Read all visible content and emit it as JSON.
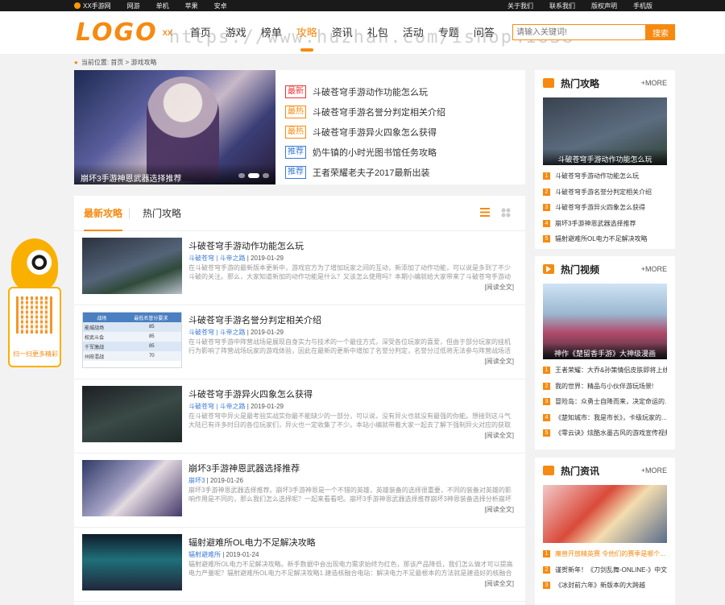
{
  "topbar": {
    "left": [
      "XX手游网",
      "网游",
      "单机",
      "苹果",
      "安卓"
    ],
    "right": [
      "关于我们",
      "联系我们",
      "版权声明",
      "手机版"
    ]
  },
  "header": {
    "logo": "LOGO",
    "logo_tag": "XX",
    "watermark": "https://www.huzhan.com/ishop41638",
    "nav": [
      "首页",
      "游戏",
      "榜单",
      "攻略",
      "资讯",
      "礼包",
      "活动",
      "专题",
      "问答"
    ],
    "search_placeholder": "请输入关键词!",
    "search_button": "搜索"
  },
  "breadcrumb": {
    "label": "当前位置:",
    "home": "首页",
    "sep": ">",
    "current": "游戏攻略"
  },
  "feature": {
    "slide_caption": "崩坏3手游神恩武器选择推荐",
    "items": [
      {
        "tag": "最新",
        "title": "斗破苍穹手游动作功能怎么玩"
      },
      {
        "tag": "最热",
        "title": "斗破苍穹手游名誉分判定相关介绍"
      },
      {
        "tag": "最热",
        "title": "斗破苍穹手游异火四象怎么获得"
      },
      {
        "tag": "推荐",
        "title": "奶牛镇的小时光图书馆任务攻略"
      },
      {
        "tag": "推荐",
        "title": "王者荣耀老夫子2017最新出装"
      }
    ]
  },
  "main": {
    "tabs": [
      "最新攻略",
      "热门攻略"
    ],
    "readmore": "[阅读全文]",
    "articles": [
      {
        "title": "斗破苍穹手游动作功能怎么玩",
        "author": "斗破苍穹 | 斗帝之路",
        "date": "2019-01-29",
        "desc": "在斗破苍穹手游的最新版本更新中，游戏官方为了增加玩家之间的互动，新添加了动作功能，可以说是多到了不少斗破的关注。那么，大家知道新加的动作功能是什么？又该怎么使用吗？本期小编就给大家带来了斗破苍穹手游动作功能怎么玩的"
      },
      {
        "title": "斗破苍穹手游名誉分判定相关介绍",
        "author": "斗破苍穹 | 斗帝之路",
        "date": "2019-01-29",
        "desc": "在斗破苍穹手游中阵营战场是展现自身实力与技术的一个最佳方式，深受各位玩家的喜爱，但由于部分玩家的挂机行为影响了阵营战场玩家的游戏体验，因此在最新的更新中增加了名誉分判定，名誉分过低将无法参与阵营战场活动。那么，斗破苍穹"
      },
      {
        "title": "斗破苍穹手游异火四象怎么获得",
        "author": "斗破苍穹 | 斗帝之路",
        "date": "2019-01-29",
        "desc": "在斗破苍穹中异火是最考验实战实你最不能缺少的一部分，可以说，没有异火也就没有最强的你能。想接到这斗气大陆已有许多时日的各位玩家们，异火也一定收集了不少。本站小编就带着大家一起去了解下强制异火对应的获取——异火四象，下面"
      },
      {
        "title": "崩坏3手游神恩武器选择推荐",
        "author": "崩坏3",
        "date": "2019-01-26",
        "desc": "崩坏3手游神恩武器选择推荐。崩坏3手游神恩是一个不错的英雄，英雄装备的选择很重要，不同的装备对英雄的影响作用是不同的，那么我们怎么选择呢？一起来看看吧。崩坏3手游神恩武器选择推荐崩坏3神恩装备选择分析崩坏3的我大-血之游戏"
      },
      {
        "title": "辐射避难所OL电力不足解决攻略",
        "author": "辐射避难所",
        "date": "2019-01-24",
        "desc": "辐射避难所OL电力不足解决攻略。新手数据中会出现电力需求始终为红色，那该产品降低，我们怎么做才可以提高电力产量呢？辐射避难所OL电力不足解决攻略1.建造核融合电站：解决电力不足最根本的方法就是建造好的核融合电站。一个发展成"
      }
    ],
    "table": {
      "headers": [
        "战场",
        "最低名誉分要求"
      ],
      "rows": [
        [
          "能城战场",
          "85"
        ],
        [
          "权武斗会",
          "85"
        ],
        [
          "千军激战",
          "85"
        ],
        [
          "州府混战",
          "70"
        ]
      ]
    }
  },
  "sidebar": {
    "more": "+MORE",
    "guides": {
      "title": "热门攻略",
      "img_caption": "斗破苍穹手游动作功能怎么玩",
      "items": [
        "斗破苍穹手游动作功能怎么玩",
        "斗破苍穹手游名誉分判定相关介绍",
        "斗破苍穹手游异火四象怎么获得",
        "崩坏3手游神恩武器选择推荐",
        "辐射避难所OL电力不足解决攻略"
      ]
    },
    "videos": {
      "title": "热门视频",
      "img_caption": "神作《楚留香手游》大神级漫画",
      "items": [
        "王者荣耀：大乔&孙策情侣皮肤即将上线~",
        "我的世界：精品与小伙伴游玩场景!",
        "冒险岛：众勇士自降而来，决定命运的...",
        "《楚知城市：我是市长》，卡级玩家的...",
        "《零云诀》炫酷水墨古风的游戏宣传视频"
      ]
    },
    "news": {
      "title": "热门资讯",
      "items": [
        "魔兽开放精英赛 令他们的赛季是哪个...",
        "谨贺新年！《刀剑乱舞-ONLINE-》中文...",
        "《冰封前六年》新版本的大跨越"
      ]
    }
  },
  "float": {
    "scan": "扫一扫更多精彩"
  },
  "colors": {
    "accent": "#f68a10",
    "link": "#3a7bd5",
    "new": "#e33333"
  }
}
